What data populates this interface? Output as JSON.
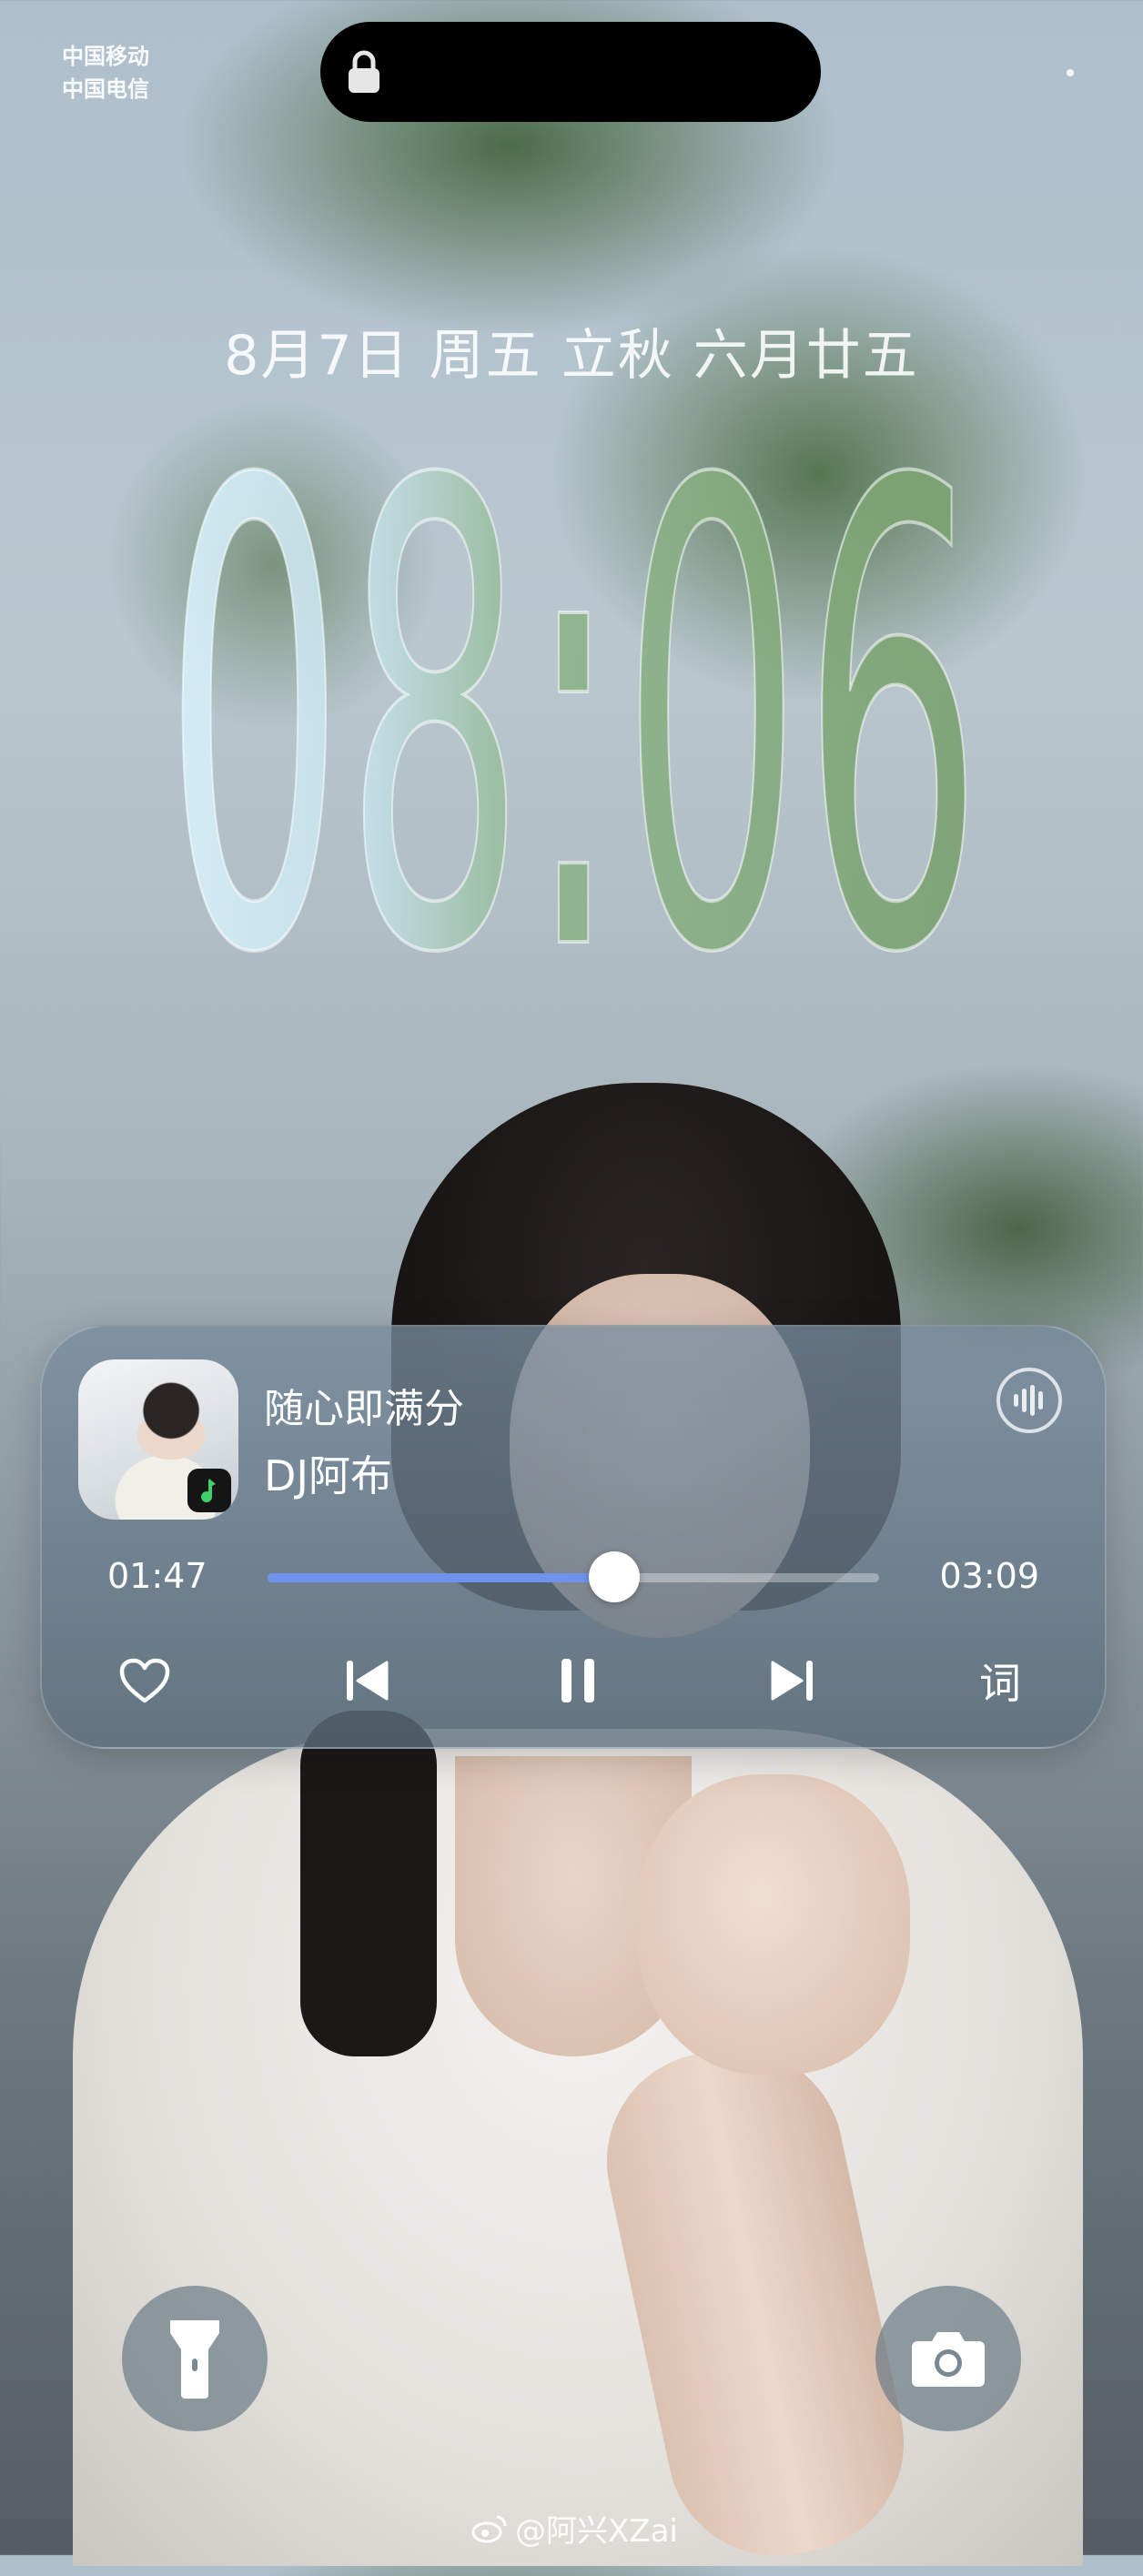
{
  "status_bar": {
    "carrier_1": "中国移动",
    "carrier_2": "中国电信",
    "lock_state": "locked"
  },
  "lock_screen": {
    "date_line": "8月7日 周五 立秋 六月廿五",
    "time": "08:06"
  },
  "music_player": {
    "song_title": "随心即满分",
    "artist": "DJ阿布",
    "current_time": "01:47",
    "total_time": "03:09",
    "progress_fraction": 0.5663,
    "progress_color": "#6f93ec",
    "lyrics_label": "词",
    "icons": {
      "visualizer": "sound-wave-icon",
      "favorite": "heart-icon",
      "previous": "previous-track-icon",
      "pause": "pause-icon",
      "next": "next-track-icon",
      "app_badge": "music-note-icon"
    }
  },
  "quick_actions": {
    "left": "flashlight-icon",
    "right": "camera-icon"
  },
  "watermark": {
    "text": "@阿兴XZai",
    "icon": "weibo-icon"
  }
}
